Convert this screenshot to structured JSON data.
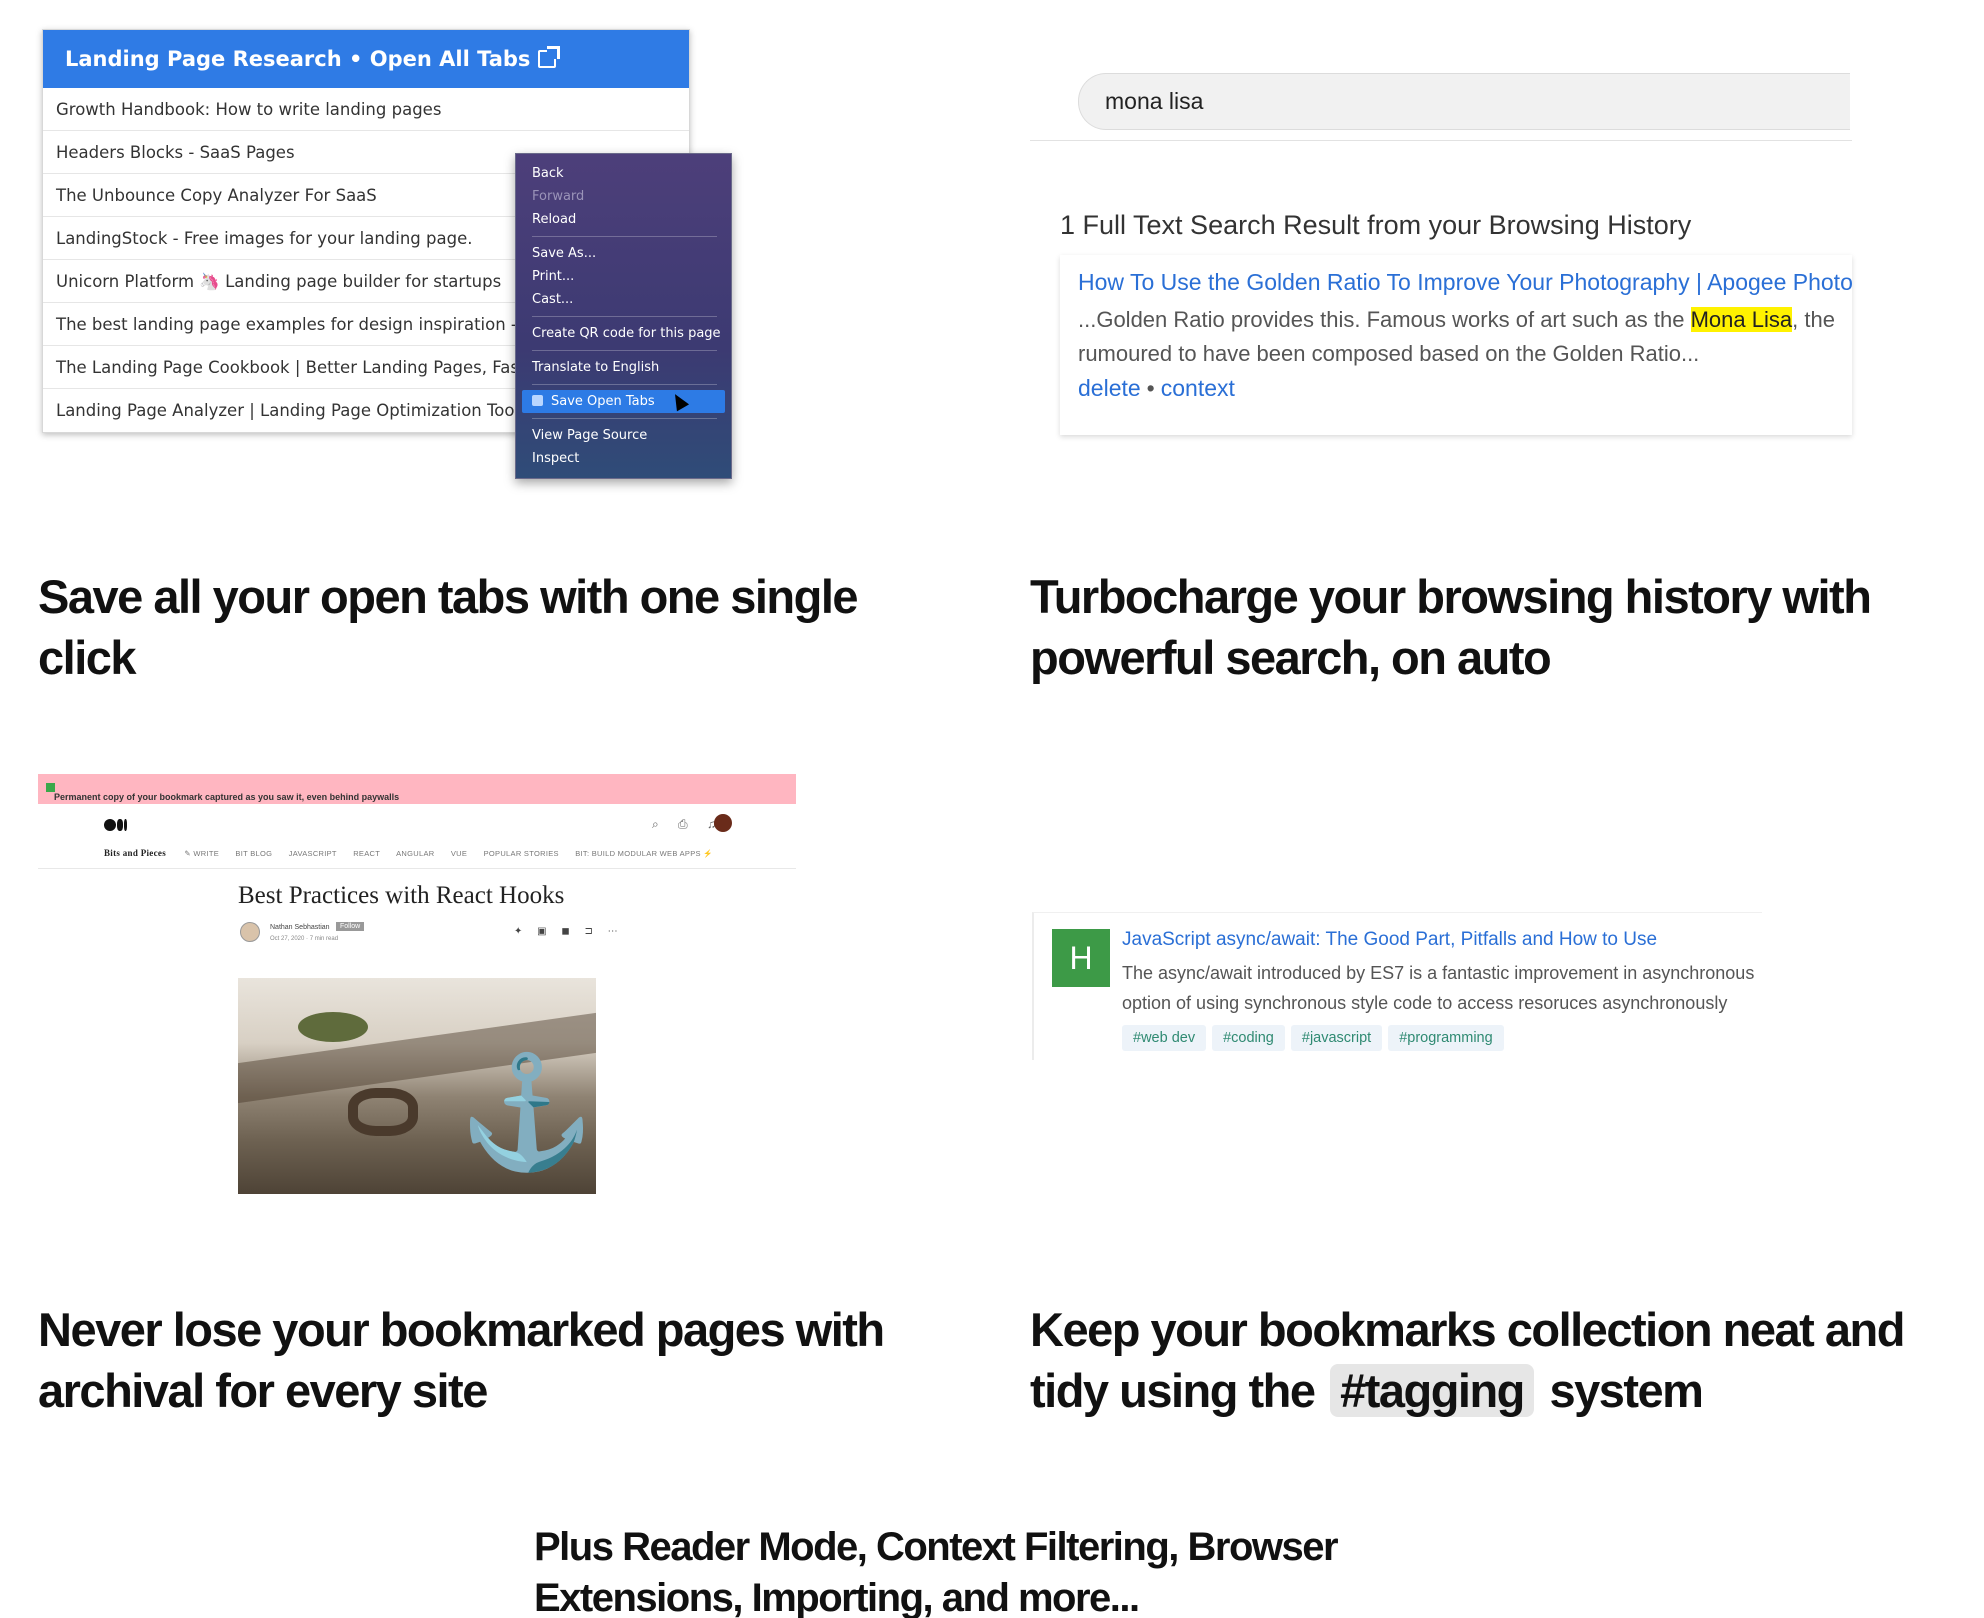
{
  "panel_tabs": {
    "header_title": "Landing Page Research • Open All Tabs",
    "tabs": [
      "Growth Handbook: How to write landing pages",
      "Headers Blocks - SaaS Pages",
      "The Unbounce Copy Analyzer For SaaS",
      "LandingStock - Free images for your landing page.",
      "Unicorn Platform 🦄 Landing page builder for startups",
      "The best landing page examples for design inspiration - SaaS",
      "The Landing Page Cookbook | Better Landing Pages, Faster",
      "Landing Page Analyzer | Landing Page Optimization Tool"
    ],
    "context_menu": {
      "back": "Back",
      "forward": "Forward",
      "reload": "Reload",
      "save_as": "Save As...",
      "print": "Print...",
      "cast": "Cast...",
      "qr": "Create QR code for this page",
      "translate": "Translate to English",
      "save_open_tabs": "Save Open Tabs",
      "view_source": "View Page Source",
      "inspect": "Inspect"
    }
  },
  "panel_search": {
    "query": "mona lisa",
    "result_count": "1 Full Text Search Result from your Browsing History",
    "result_title": "How To Use the Golden Ratio To Improve Your Photography | Apogee Photo",
    "snippet_before": "...Golden Ratio provides this. Famous works of art such as the ",
    "snippet_highlight": "Mona Lisa",
    "snippet_after": ", the",
    "snippet_line2": "rumoured to have been composed based on the Golden Ratio...",
    "action_delete": "delete",
    "action_sep": "•",
    "action_context": "context"
  },
  "headlines": {
    "h1": "Save all your open tabs with one single click",
    "h2": "Turbocharge your browsing history with powerful search, on auto",
    "h3": "Never lose your bookmarked pages with archival for every site",
    "h4_before": "Keep your bookmarks collection neat and tidy using the",
    "h4_tag": "#tagging",
    "h4_after": "system",
    "h5": "Plus Reader Mode, Context Filtering, Browser Extensions, Importing, and more..."
  },
  "panel_archive": {
    "banner": "Permanent copy of your bookmark captured as you saw it, even behind paywalls",
    "publication": "Bits and Pieces",
    "nav": [
      "✎ WRITE",
      "BIT BLOG",
      "JAVASCRIPT",
      "REACT",
      "ANGULAR",
      "VUE",
      "POPULAR STORIES",
      "BIT: BUILD MODULAR WEB APPS ⚡"
    ],
    "article_title": "Best Practices with React Hooks",
    "author": "Nathan Sebhastian",
    "follow": "Follow",
    "date": "Oct 27, 2020 · 7 min read"
  },
  "panel_bookmark": {
    "avatar_letter": "H",
    "title": "JavaScript async/await: The Good Part, Pitfalls and How to Use",
    "desc_line1": "The async/await introduced by ES7 is a fantastic improvement in asynchronous",
    "desc_line2": "option of using synchronous style code to access resoruces asynchronously",
    "tags": [
      "#web dev",
      "#coding",
      "#javascript",
      "#programming"
    ]
  },
  "colors": {
    "header_blue": "#2f7be5",
    "link_blue": "#2a6fd6",
    "highlight": "#fff200",
    "banner_pink": "#ffb6c1",
    "avatar_green": "#3d9a47",
    "tag_text": "#2f8a72"
  }
}
